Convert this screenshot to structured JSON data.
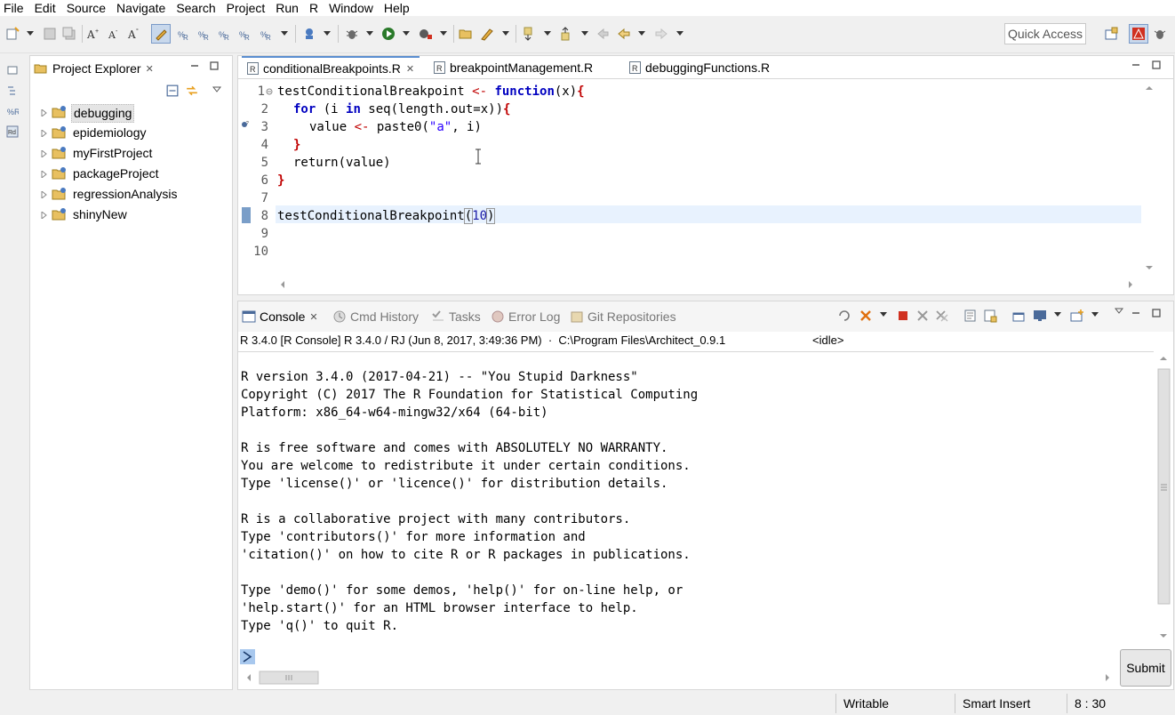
{
  "menubar": {
    "items": [
      "File",
      "Edit",
      "Source",
      "Navigate",
      "Search",
      "Project",
      "Run",
      "R",
      "Window",
      "Help"
    ]
  },
  "toolbar": {
    "quick_access_placeholder": "Quick Access"
  },
  "project_explorer": {
    "title": "Project Explorer",
    "projects": [
      "debugging",
      "epidemiology",
      "myFirstProject",
      "packageProject",
      "regressionAnalysis",
      "shinyNew"
    ],
    "selected": "debugging"
  },
  "editor": {
    "tabs": [
      {
        "label": "conditionalBreakpoints.R",
        "active": true
      },
      {
        "label": "breakpointManagement.R",
        "active": false
      },
      {
        "label": "debuggingFunctions.R",
        "active": false
      }
    ],
    "line_numbers": [
      "1",
      "2",
      "3",
      "4",
      "5",
      "6",
      "7",
      "8",
      "9",
      "10"
    ],
    "code": {
      "l1_name": "testConditionalBreakpoint",
      "l1_assign": " <- ",
      "l1_fn": "function",
      "l1_args": "(x)",
      "l1_open": "{",
      "l2_for": "for",
      "l2_paren": " (i ",
      "l2_in": "in",
      "l2_rest": " seq(length.out=x))",
      "l2_open": "{",
      "l3_var": "value",
      "l3_assign": " <- ",
      "l3_call": "paste0(",
      "l3_str": "\"a\"",
      "l3_rest": ", i)",
      "l4_close": "}",
      "l5_text": "return(value)",
      "l6_close": "}",
      "l8_name": "testConditionalBreakpoint",
      "l8_open": "(",
      "l8_num": "10",
      "l8_close": ")"
    }
  },
  "console": {
    "tabs": [
      {
        "label": "Console",
        "active": true
      },
      {
        "label": "Cmd History",
        "active": false
      },
      {
        "label": "Tasks",
        "active": false
      },
      {
        "label": "Error Log",
        "active": false
      },
      {
        "label": "Git Repositories",
        "active": false
      }
    ],
    "info_line": "R 3.4.0 [R Console] R 3.4.0 / RJ (Jun 8, 2017, 3:49:36 PM)  ·  C:\\Program Files\\Architect_0.9.1",
    "state": "<idle>",
    "output": [
      "R version 3.4.0 (2017-04-21) -- \"You Stupid Darkness\"",
      "Copyright (C) 2017 The R Foundation for Statistical Computing",
      "Platform: x86_64-w64-mingw32/x64 (64-bit)",
      "",
      "R is free software and comes with ABSOLUTELY NO WARRANTY.",
      "You are welcome to redistribute it under certain conditions.",
      "Type 'license()' or 'licence()' for distribution details.",
      "",
      "R is a collaborative project with many contributors.",
      "Type 'contributors()' for more information and",
      "'citation()' on how to cite R or R packages in publications.",
      "",
      "Type 'demo()' for some demos, 'help()' for on-line help, or",
      "'help.start()' for an HTML browser interface to help.",
      "Type 'q()' to quit R."
    ],
    "submit_label": "Submit"
  },
  "statusbar": {
    "mode": "Writable",
    "insert_mode": "Smart Insert",
    "position": "8 : 30"
  },
  "colors": {
    "accent": "#5a8ed0",
    "current_line": "#e8f2fe",
    "keyword": "#0000c0",
    "operator": "#c00000"
  }
}
